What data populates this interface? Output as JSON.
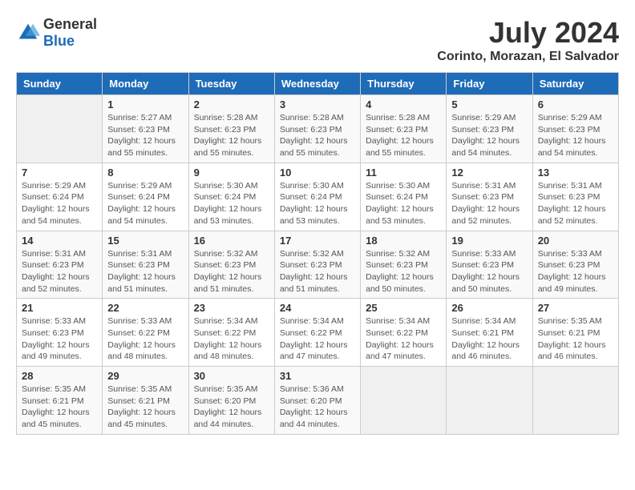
{
  "logo": {
    "general": "General",
    "blue": "Blue"
  },
  "title": {
    "month_year": "July 2024",
    "location": "Corinto, Morazan, El Salvador"
  },
  "calendar": {
    "headers": [
      "Sunday",
      "Monday",
      "Tuesday",
      "Wednesday",
      "Thursday",
      "Friday",
      "Saturday"
    ],
    "weeks": [
      [
        {
          "day": "",
          "info": ""
        },
        {
          "day": "1",
          "info": "Sunrise: 5:27 AM\nSunset: 6:23 PM\nDaylight: 12 hours\nand 55 minutes."
        },
        {
          "day": "2",
          "info": "Sunrise: 5:28 AM\nSunset: 6:23 PM\nDaylight: 12 hours\nand 55 minutes."
        },
        {
          "day": "3",
          "info": "Sunrise: 5:28 AM\nSunset: 6:23 PM\nDaylight: 12 hours\nand 55 minutes."
        },
        {
          "day": "4",
          "info": "Sunrise: 5:28 AM\nSunset: 6:23 PM\nDaylight: 12 hours\nand 55 minutes."
        },
        {
          "day": "5",
          "info": "Sunrise: 5:29 AM\nSunset: 6:23 PM\nDaylight: 12 hours\nand 54 minutes."
        },
        {
          "day": "6",
          "info": "Sunrise: 5:29 AM\nSunset: 6:23 PM\nDaylight: 12 hours\nand 54 minutes."
        }
      ],
      [
        {
          "day": "7",
          "info": "Sunrise: 5:29 AM\nSunset: 6:24 PM\nDaylight: 12 hours\nand 54 minutes."
        },
        {
          "day": "8",
          "info": "Sunrise: 5:29 AM\nSunset: 6:24 PM\nDaylight: 12 hours\nand 54 minutes."
        },
        {
          "day": "9",
          "info": "Sunrise: 5:30 AM\nSunset: 6:24 PM\nDaylight: 12 hours\nand 53 minutes."
        },
        {
          "day": "10",
          "info": "Sunrise: 5:30 AM\nSunset: 6:24 PM\nDaylight: 12 hours\nand 53 minutes."
        },
        {
          "day": "11",
          "info": "Sunrise: 5:30 AM\nSunset: 6:24 PM\nDaylight: 12 hours\nand 53 minutes."
        },
        {
          "day": "12",
          "info": "Sunrise: 5:31 AM\nSunset: 6:23 PM\nDaylight: 12 hours\nand 52 minutes."
        },
        {
          "day": "13",
          "info": "Sunrise: 5:31 AM\nSunset: 6:23 PM\nDaylight: 12 hours\nand 52 minutes."
        }
      ],
      [
        {
          "day": "14",
          "info": "Sunrise: 5:31 AM\nSunset: 6:23 PM\nDaylight: 12 hours\nand 52 minutes."
        },
        {
          "day": "15",
          "info": "Sunrise: 5:31 AM\nSunset: 6:23 PM\nDaylight: 12 hours\nand 51 minutes."
        },
        {
          "day": "16",
          "info": "Sunrise: 5:32 AM\nSunset: 6:23 PM\nDaylight: 12 hours\nand 51 minutes."
        },
        {
          "day": "17",
          "info": "Sunrise: 5:32 AM\nSunset: 6:23 PM\nDaylight: 12 hours\nand 51 minutes."
        },
        {
          "day": "18",
          "info": "Sunrise: 5:32 AM\nSunset: 6:23 PM\nDaylight: 12 hours\nand 50 minutes."
        },
        {
          "day": "19",
          "info": "Sunrise: 5:33 AM\nSunset: 6:23 PM\nDaylight: 12 hours\nand 50 minutes."
        },
        {
          "day": "20",
          "info": "Sunrise: 5:33 AM\nSunset: 6:23 PM\nDaylight: 12 hours\nand 49 minutes."
        }
      ],
      [
        {
          "day": "21",
          "info": "Sunrise: 5:33 AM\nSunset: 6:23 PM\nDaylight: 12 hours\nand 49 minutes."
        },
        {
          "day": "22",
          "info": "Sunrise: 5:33 AM\nSunset: 6:22 PM\nDaylight: 12 hours\nand 48 minutes."
        },
        {
          "day": "23",
          "info": "Sunrise: 5:34 AM\nSunset: 6:22 PM\nDaylight: 12 hours\nand 48 minutes."
        },
        {
          "day": "24",
          "info": "Sunrise: 5:34 AM\nSunset: 6:22 PM\nDaylight: 12 hours\nand 47 minutes."
        },
        {
          "day": "25",
          "info": "Sunrise: 5:34 AM\nSunset: 6:22 PM\nDaylight: 12 hours\nand 47 minutes."
        },
        {
          "day": "26",
          "info": "Sunrise: 5:34 AM\nSunset: 6:21 PM\nDaylight: 12 hours\nand 46 minutes."
        },
        {
          "day": "27",
          "info": "Sunrise: 5:35 AM\nSunset: 6:21 PM\nDaylight: 12 hours\nand 46 minutes."
        }
      ],
      [
        {
          "day": "28",
          "info": "Sunrise: 5:35 AM\nSunset: 6:21 PM\nDaylight: 12 hours\nand 45 minutes."
        },
        {
          "day": "29",
          "info": "Sunrise: 5:35 AM\nSunset: 6:21 PM\nDaylight: 12 hours\nand 45 minutes."
        },
        {
          "day": "30",
          "info": "Sunrise: 5:35 AM\nSunset: 6:20 PM\nDaylight: 12 hours\nand 44 minutes."
        },
        {
          "day": "31",
          "info": "Sunrise: 5:36 AM\nSunset: 6:20 PM\nDaylight: 12 hours\nand 44 minutes."
        },
        {
          "day": "",
          "info": ""
        },
        {
          "day": "",
          "info": ""
        },
        {
          "day": "",
          "info": ""
        }
      ]
    ]
  }
}
